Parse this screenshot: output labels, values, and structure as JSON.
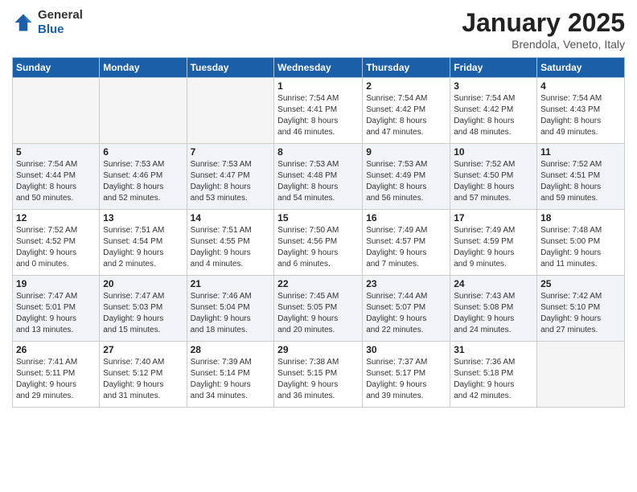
{
  "header": {
    "logo_general": "General",
    "logo_blue": "Blue",
    "title": "January 2025",
    "location": "Brendola, Veneto, Italy"
  },
  "columns": [
    "Sunday",
    "Monday",
    "Tuesday",
    "Wednesday",
    "Thursday",
    "Friday",
    "Saturday"
  ],
  "weeks": [
    [
      {
        "day": "",
        "info": ""
      },
      {
        "day": "",
        "info": ""
      },
      {
        "day": "",
        "info": ""
      },
      {
        "day": "1",
        "info": "Sunrise: 7:54 AM\nSunset: 4:41 PM\nDaylight: 8 hours\nand 46 minutes."
      },
      {
        "day": "2",
        "info": "Sunrise: 7:54 AM\nSunset: 4:42 PM\nDaylight: 8 hours\nand 47 minutes."
      },
      {
        "day": "3",
        "info": "Sunrise: 7:54 AM\nSunset: 4:42 PM\nDaylight: 8 hours\nand 48 minutes."
      },
      {
        "day": "4",
        "info": "Sunrise: 7:54 AM\nSunset: 4:43 PM\nDaylight: 8 hours\nand 49 minutes."
      }
    ],
    [
      {
        "day": "5",
        "info": "Sunrise: 7:54 AM\nSunset: 4:44 PM\nDaylight: 8 hours\nand 50 minutes."
      },
      {
        "day": "6",
        "info": "Sunrise: 7:53 AM\nSunset: 4:46 PM\nDaylight: 8 hours\nand 52 minutes."
      },
      {
        "day": "7",
        "info": "Sunrise: 7:53 AM\nSunset: 4:47 PM\nDaylight: 8 hours\nand 53 minutes."
      },
      {
        "day": "8",
        "info": "Sunrise: 7:53 AM\nSunset: 4:48 PM\nDaylight: 8 hours\nand 54 minutes."
      },
      {
        "day": "9",
        "info": "Sunrise: 7:53 AM\nSunset: 4:49 PM\nDaylight: 8 hours\nand 56 minutes."
      },
      {
        "day": "10",
        "info": "Sunrise: 7:52 AM\nSunset: 4:50 PM\nDaylight: 8 hours\nand 57 minutes."
      },
      {
        "day": "11",
        "info": "Sunrise: 7:52 AM\nSunset: 4:51 PM\nDaylight: 8 hours\nand 59 minutes."
      }
    ],
    [
      {
        "day": "12",
        "info": "Sunrise: 7:52 AM\nSunset: 4:52 PM\nDaylight: 9 hours\nand 0 minutes."
      },
      {
        "day": "13",
        "info": "Sunrise: 7:51 AM\nSunset: 4:54 PM\nDaylight: 9 hours\nand 2 minutes."
      },
      {
        "day": "14",
        "info": "Sunrise: 7:51 AM\nSunset: 4:55 PM\nDaylight: 9 hours\nand 4 minutes."
      },
      {
        "day": "15",
        "info": "Sunrise: 7:50 AM\nSunset: 4:56 PM\nDaylight: 9 hours\nand 6 minutes."
      },
      {
        "day": "16",
        "info": "Sunrise: 7:49 AM\nSunset: 4:57 PM\nDaylight: 9 hours\nand 7 minutes."
      },
      {
        "day": "17",
        "info": "Sunrise: 7:49 AM\nSunset: 4:59 PM\nDaylight: 9 hours\nand 9 minutes."
      },
      {
        "day": "18",
        "info": "Sunrise: 7:48 AM\nSunset: 5:00 PM\nDaylight: 9 hours\nand 11 minutes."
      }
    ],
    [
      {
        "day": "19",
        "info": "Sunrise: 7:47 AM\nSunset: 5:01 PM\nDaylight: 9 hours\nand 13 minutes."
      },
      {
        "day": "20",
        "info": "Sunrise: 7:47 AM\nSunset: 5:03 PM\nDaylight: 9 hours\nand 15 minutes."
      },
      {
        "day": "21",
        "info": "Sunrise: 7:46 AM\nSunset: 5:04 PM\nDaylight: 9 hours\nand 18 minutes."
      },
      {
        "day": "22",
        "info": "Sunrise: 7:45 AM\nSunset: 5:05 PM\nDaylight: 9 hours\nand 20 minutes."
      },
      {
        "day": "23",
        "info": "Sunrise: 7:44 AM\nSunset: 5:07 PM\nDaylight: 9 hours\nand 22 minutes."
      },
      {
        "day": "24",
        "info": "Sunrise: 7:43 AM\nSunset: 5:08 PM\nDaylight: 9 hours\nand 24 minutes."
      },
      {
        "day": "25",
        "info": "Sunrise: 7:42 AM\nSunset: 5:10 PM\nDaylight: 9 hours\nand 27 minutes."
      }
    ],
    [
      {
        "day": "26",
        "info": "Sunrise: 7:41 AM\nSunset: 5:11 PM\nDaylight: 9 hours\nand 29 minutes."
      },
      {
        "day": "27",
        "info": "Sunrise: 7:40 AM\nSunset: 5:12 PM\nDaylight: 9 hours\nand 31 minutes."
      },
      {
        "day": "28",
        "info": "Sunrise: 7:39 AM\nSunset: 5:14 PM\nDaylight: 9 hours\nand 34 minutes."
      },
      {
        "day": "29",
        "info": "Sunrise: 7:38 AM\nSunset: 5:15 PM\nDaylight: 9 hours\nand 36 minutes."
      },
      {
        "day": "30",
        "info": "Sunrise: 7:37 AM\nSunset: 5:17 PM\nDaylight: 9 hours\nand 39 minutes."
      },
      {
        "day": "31",
        "info": "Sunrise: 7:36 AM\nSunset: 5:18 PM\nDaylight: 9 hours\nand 42 minutes."
      },
      {
        "day": "",
        "info": ""
      }
    ]
  ]
}
